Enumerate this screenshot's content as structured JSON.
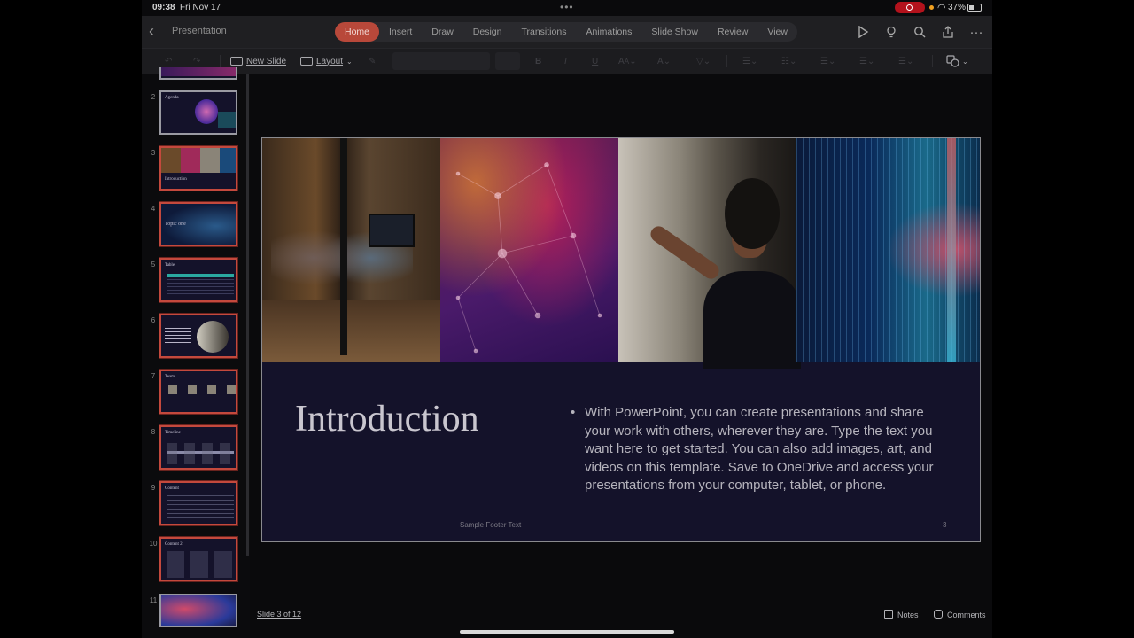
{
  "status": {
    "time": "09:38",
    "date": "Fri Nov 17",
    "battery": "37%"
  },
  "header": {
    "title": "Presentation",
    "tabs": [
      {
        "label": "Home",
        "active": true
      },
      {
        "label": "Insert"
      },
      {
        "label": "Draw"
      },
      {
        "label": "Design"
      },
      {
        "label": "Transitions"
      },
      {
        "label": "Animations"
      },
      {
        "label": "Slide Show"
      },
      {
        "label": "Review"
      },
      {
        "label": "View"
      }
    ]
  },
  "ribbon": {
    "new_slide": "New Slide",
    "layout": "Layout"
  },
  "thumbnails": [
    {
      "num": "2",
      "title": "Agenda"
    },
    {
      "num": "3",
      "title": "Introduction"
    },
    {
      "num": "4",
      "title": "Topic one"
    },
    {
      "num": "5",
      "title": "Table"
    },
    {
      "num": "6",
      "title": ""
    },
    {
      "num": "7",
      "title": "Team"
    },
    {
      "num": "8",
      "title": "Timeline"
    },
    {
      "num": "9",
      "title": "Content"
    },
    {
      "num": "10",
      "title": "Content 2"
    },
    {
      "num": "11",
      "title": ""
    }
  ],
  "slide": {
    "title": "Introduction",
    "body": "With PowerPoint, you can create presentations and share your work with others, wherever they are. Type the text you want here to get started. You can also add images, art, and videos on this template. Save to OneDrive and access your presentations from your computer, tablet, or phone.",
    "footer": "Sample Footer Text",
    "number": "3"
  },
  "bottom": {
    "slide_indicator": "Slide 3 of 12",
    "notes": "Notes",
    "comments": "Comments"
  },
  "colors": {
    "accent": "#b8483a",
    "slide_bg": "#14122a"
  }
}
